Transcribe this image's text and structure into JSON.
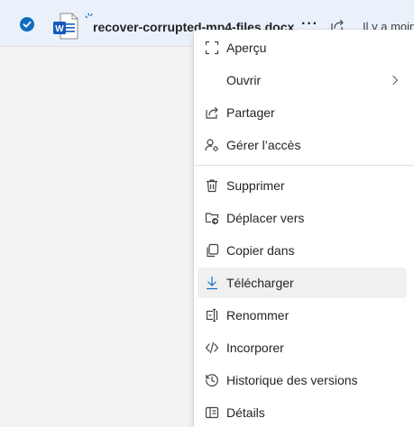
{
  "file_row": {
    "name": "recover-corrupted-mp4-files.docx",
    "more_label": "···",
    "modified": "Il y a moins",
    "icon": "word-doc-icon",
    "selected": true
  },
  "menu": {
    "items": [
      {
        "label": "Aperçu",
        "icon": "preview-icon"
      },
      {
        "label": "Ouvrir",
        "icon": "none",
        "submenu": true
      },
      {
        "label": "Partager",
        "icon": "share-icon"
      },
      {
        "label": "Gérer l’accès",
        "icon": "manage-access-icon"
      },
      {
        "label": "Supprimer",
        "icon": "trash-icon"
      },
      {
        "label": "Déplacer vers",
        "icon": "move-folder-icon"
      },
      {
        "label": "Copier dans",
        "icon": "copy-icon"
      },
      {
        "label": "Télécharger",
        "icon": "download-icon",
        "highlighted": true
      },
      {
        "label": "Renommer",
        "icon": "rename-icon"
      },
      {
        "label": "Incorporer",
        "icon": "embed-icon"
      },
      {
        "label": "Historique des versions",
        "icon": "history-icon"
      },
      {
        "label": "Détails",
        "icon": "details-icon"
      }
    ]
  },
  "colors": {
    "accent": "#0f6cbd",
    "word_blue": "#185abd",
    "selected_row": "#eaf1fb",
    "hover_item": "#f0f0f0"
  }
}
